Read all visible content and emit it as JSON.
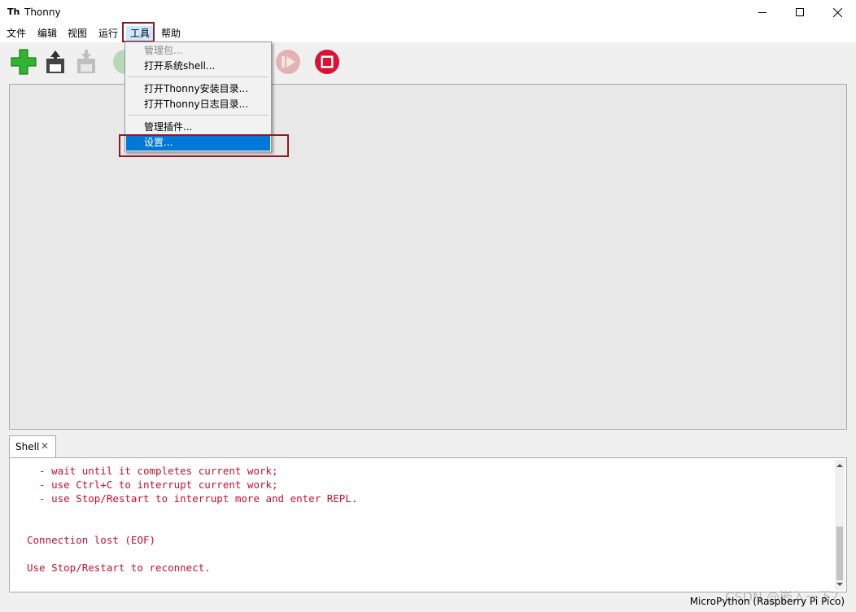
{
  "window": {
    "title": "Thonny",
    "app_icon": "thonny-icon"
  },
  "menubar": {
    "items": [
      "文件",
      "编辑",
      "视图",
      "运行",
      "工具",
      "帮助"
    ]
  },
  "toolbar": {
    "buttons": [
      {
        "name": "new-file",
        "icon": "plus-icon"
      },
      {
        "name": "open-file",
        "icon": "folder-open-icon"
      },
      {
        "name": "save-file",
        "icon": "save-icon"
      },
      {
        "name": "run",
        "icon": "run-icon"
      },
      {
        "name": "resume",
        "icon": "resume-icon"
      },
      {
        "name": "stop",
        "icon": "stop-icon"
      }
    ]
  },
  "tools_menu": {
    "items": [
      {
        "label": "管理包...",
        "disabled": true
      },
      {
        "label": "打开系统shell..."
      },
      {
        "label": "打开Thonny安装目录..."
      },
      {
        "label": "打开Thonny日志目录..."
      },
      {
        "label": "管理插件..."
      },
      {
        "label": "设置...",
        "selected": true
      }
    ]
  },
  "shell": {
    "tab_label": "Shell",
    "lines": [
      "  - wait until it completes current work;",
      "  - use Ctrl+C to interrupt current work;",
      "  - use Stop/Restart to interrupt more and enter REPL.",
      "",
      "",
      "Connection lost (EOF)",
      "",
      "Use Stop/Restart to reconnect."
    ]
  },
  "status": {
    "interpreter": "MicroPython (Raspberry Pi Pico)"
  },
  "watermark": "CSDN @嵌入一下？",
  "colors": {
    "accent": "#0078d7",
    "error_text": "#c8102e",
    "highlight_box": "#8b1a2a"
  }
}
